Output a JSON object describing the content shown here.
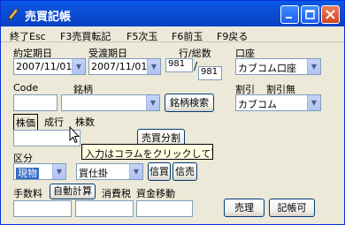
{
  "window": {
    "title": "売買記帳"
  },
  "menu": [
    "終了Esc",
    "F3売買転記",
    "F5次玉",
    "F6前玉",
    "F9戻る"
  ],
  "labels": {
    "contract_date": "約定期日",
    "delivery_date": "受渡期日",
    "row_total": "行/総数",
    "account": "口座",
    "code": "Code",
    "name": "銘柄",
    "discount": "割引",
    "no_discount": "割引無",
    "unit_price": "株価",
    "subsequent": "成行",
    "shares": "株数",
    "category": "区分",
    "fee": "手数料",
    "auto_calc": "自動計算",
    "consumption_tax": "消費税",
    "fund_transfer": "資金移動"
  },
  "fields": {
    "contract_date": "2007/11/01",
    "delivery_date": "2007/11/01",
    "row": "981",
    "total": "981",
    "account": "カブコム口座",
    "discount_broker": "カブコム",
    "category": "現物",
    "trade_type": "買仕掛"
  },
  "buttons": {
    "search_name": "銘柄検索",
    "split": "売買分割",
    "credit_buy": "信買",
    "credit_sell": "信売",
    "trade": "売理",
    "bookable": "記帳可"
  },
  "tooltip": "入力はコラムをクリックして下さい。",
  "colors": {
    "titlebar": "#0a4ed6",
    "window_bg": "#ece9d8",
    "highlight": "#316ac5"
  }
}
